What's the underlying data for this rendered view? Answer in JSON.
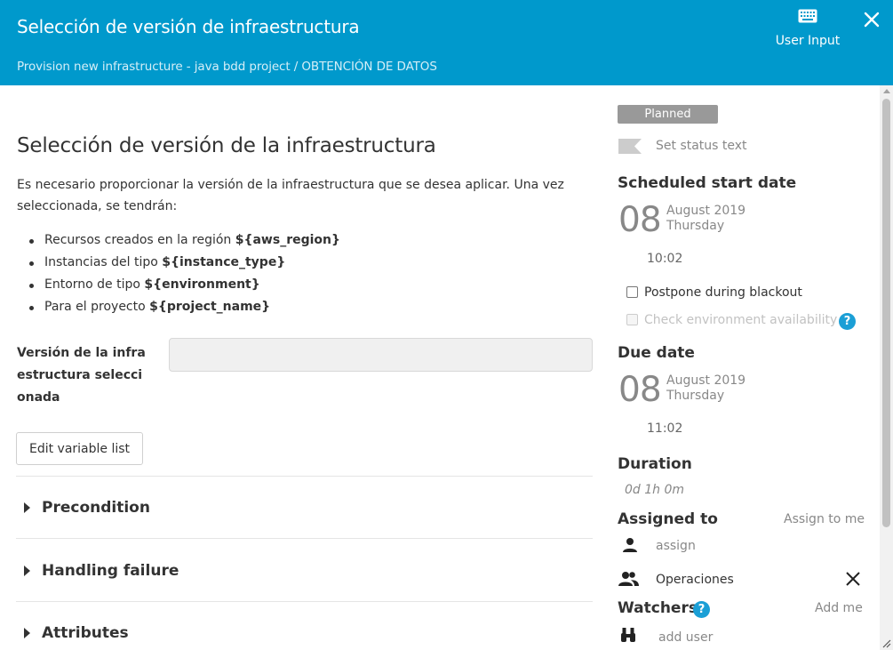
{
  "header": {
    "title": "Selección de versión de infraestructura",
    "subtitle": "Provision new infrastructure - java bdd project / OBTENCIÓN DE DATOS",
    "user_input_label": "User Input",
    "keyboard_icon": "keyboard-icon",
    "close_icon": "close-icon",
    "color": "#0099cc"
  },
  "main": {
    "title": "Selección de versión de la infraestructura",
    "description": "Es necesario proporcionar la versión de la infraestructura que se desea aplicar. Una vez seleccionada, se tendrán:",
    "bullets": [
      {
        "text": "Recursos creados en la región ",
        "bold": "${aws_region}"
      },
      {
        "text": "Instancias del tipo ",
        "bold": "${instance_type}"
      },
      {
        "text": "Entorno de tipo ",
        "bold": "${environment}"
      },
      {
        "text": "Para el proyecto ",
        "bold": "${project_name}"
      }
    ],
    "variable_label": "Versión de la infra estructura selecci onada",
    "variable_value": "",
    "edit_button": "Edit variable list",
    "sections": [
      "Precondition",
      "Handling failure",
      "Attributes"
    ]
  },
  "side": {
    "status_badge": "Planned",
    "status_text": "Set status text",
    "scheduled_heading": "Scheduled start date",
    "scheduled": {
      "day": "08",
      "month": "August 2019",
      "weekday": "Thursday",
      "time": "10:02"
    },
    "postpone_label": "Postpone during blackout",
    "check_env_label": "Check environment availability",
    "due_heading": "Due date",
    "due": {
      "day": "08",
      "month": "August 2019",
      "weekday": "Thursday",
      "time": "11:02"
    },
    "duration_heading": "Duration",
    "duration_value": "0d 1h 0m",
    "assigned_heading": "Assigned to",
    "assign_to_me": "Assign to me",
    "assign_placeholder": "assign",
    "team": "Operaciones",
    "watchers_heading": "Watchers",
    "add_me": "Add me",
    "add_user": "add user"
  }
}
